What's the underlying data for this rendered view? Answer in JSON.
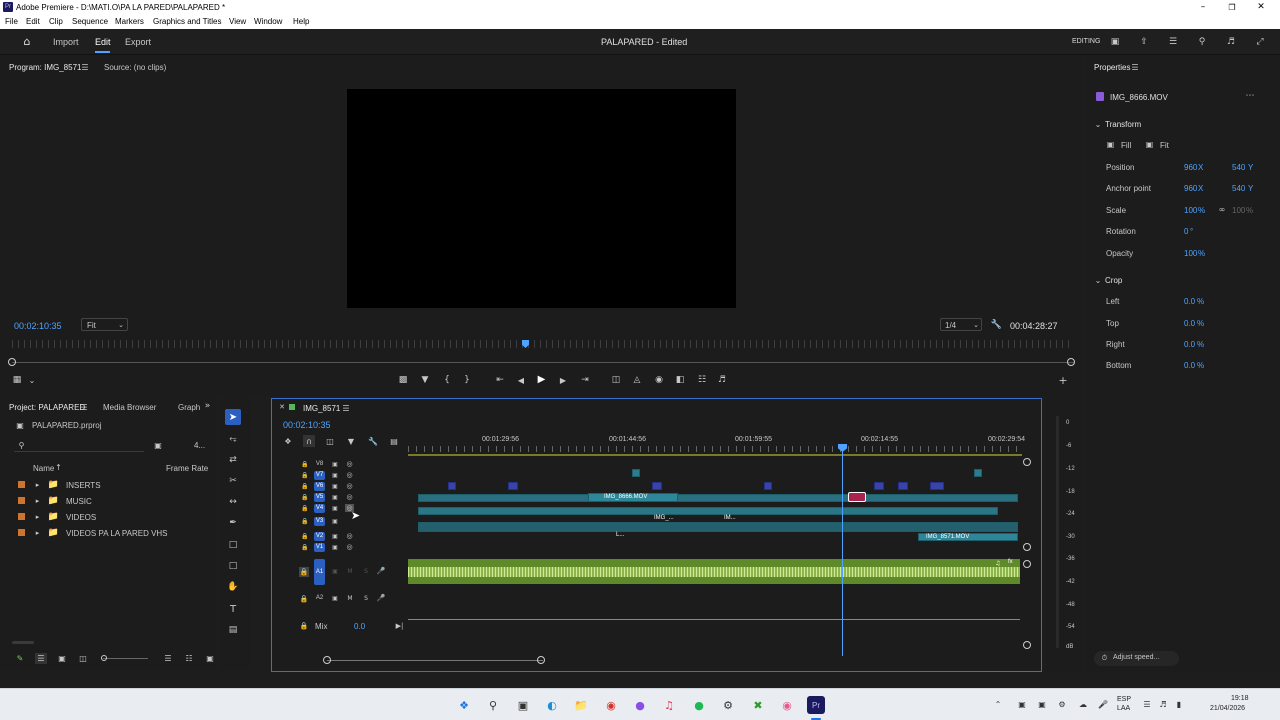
{
  "titlebar": {
    "title": "Adobe Premiere - D:\\MATI.O\\PA LA PARED\\PALAPARED *",
    "app_icon": "Pr"
  },
  "menubar": {
    "items": [
      "File",
      "Edit",
      "Clip",
      "Sequence",
      "Markers",
      "Graphics and Titles",
      "View",
      "Window",
      "Help"
    ]
  },
  "header": {
    "nav": [
      "Import",
      "Edit",
      "Export"
    ],
    "active_nav": "Edit",
    "project_title": "PALAPARED - Edited",
    "workspace": "EDITING"
  },
  "program_monitor": {
    "tab": "Program: IMG_8571",
    "source_tab": "Source: (no clips)",
    "timecode": "00:02:10:35",
    "fit": "Fit",
    "resolution": "1/4",
    "duration": "00:04:28:27"
  },
  "project_panel": {
    "tabs": [
      "Project: PALAPARED",
      "Media Browser",
      "Graph"
    ],
    "file": "PALAPARED.prproj",
    "count": "4...",
    "col_name": "Name",
    "col_frame": "Frame Rate",
    "bins": [
      "INSERTS",
      "MUSIC",
      "VIDEOS",
      "VIDEOS PA LA PARED VHS"
    ]
  },
  "timeline": {
    "sequence": "IMG_8571",
    "timecode": "00:02:10:35",
    "ruler": [
      "00:01:29:56",
      "00:01:44:56",
      "00:01:59:55",
      "00:02:14:55",
      "00:02:29:54"
    ],
    "video_tracks": [
      "V8",
      "V7",
      "V6",
      "V5",
      "V4",
      "V3",
      "V2",
      "V1"
    ],
    "audio_tracks": [
      "A1",
      "A2"
    ],
    "mix_label": "Mix",
    "mix_value": "0.0",
    "clip_labels": [
      "IMG_8666.MOV",
      "IMG_...",
      "IM...",
      "IMG_8571.MOV",
      "L..."
    ],
    "audio_marks": [
      "fx"
    ]
  },
  "meter": {
    "scale": [
      "0",
      "-6",
      "-12",
      "-18",
      "-24",
      "-30",
      "-36",
      "-42",
      "-48",
      "-54",
      "dB"
    ]
  },
  "properties": {
    "tab": "Properties",
    "clip_name": "IMG_8666.MOV",
    "transform_label": "Transform",
    "fill_label": "Fill",
    "fit_label": "Fit",
    "rows": [
      {
        "label": "Position",
        "v1": "960",
        "u1": "X",
        "v2": "540",
        "u2": "Y"
      },
      {
        "label": "Anchor point",
        "v1": "960",
        "u1": "X",
        "v2": "540",
        "u2": "Y"
      },
      {
        "label": "Scale",
        "v1": "100",
        "u1": "%",
        "v2": "100",
        "u2": "%"
      },
      {
        "label": "Rotation",
        "v1": "0",
        "u1": "°",
        "v2": "",
        "u2": ""
      },
      {
        "label": "Opacity",
        "v1": "100",
        "u1": "%",
        "v2": "",
        "u2": ""
      }
    ],
    "crop_label": "Crop",
    "crop_rows": [
      {
        "label": "Left",
        "v": "0.0",
        "u": "%"
      },
      {
        "label": "Top",
        "v": "0.0",
        "u": "%"
      },
      {
        "label": "Right",
        "v": "0.0",
        "u": "%"
      },
      {
        "label": "Bottom",
        "v": "0.0",
        "u": "%"
      }
    ],
    "adjust_speed": "Adjust speed..."
  },
  "taskbar": {
    "lang1": "ESP",
    "lang2": "LAA",
    "time": "19:18",
    "date": "21/04/2026"
  }
}
